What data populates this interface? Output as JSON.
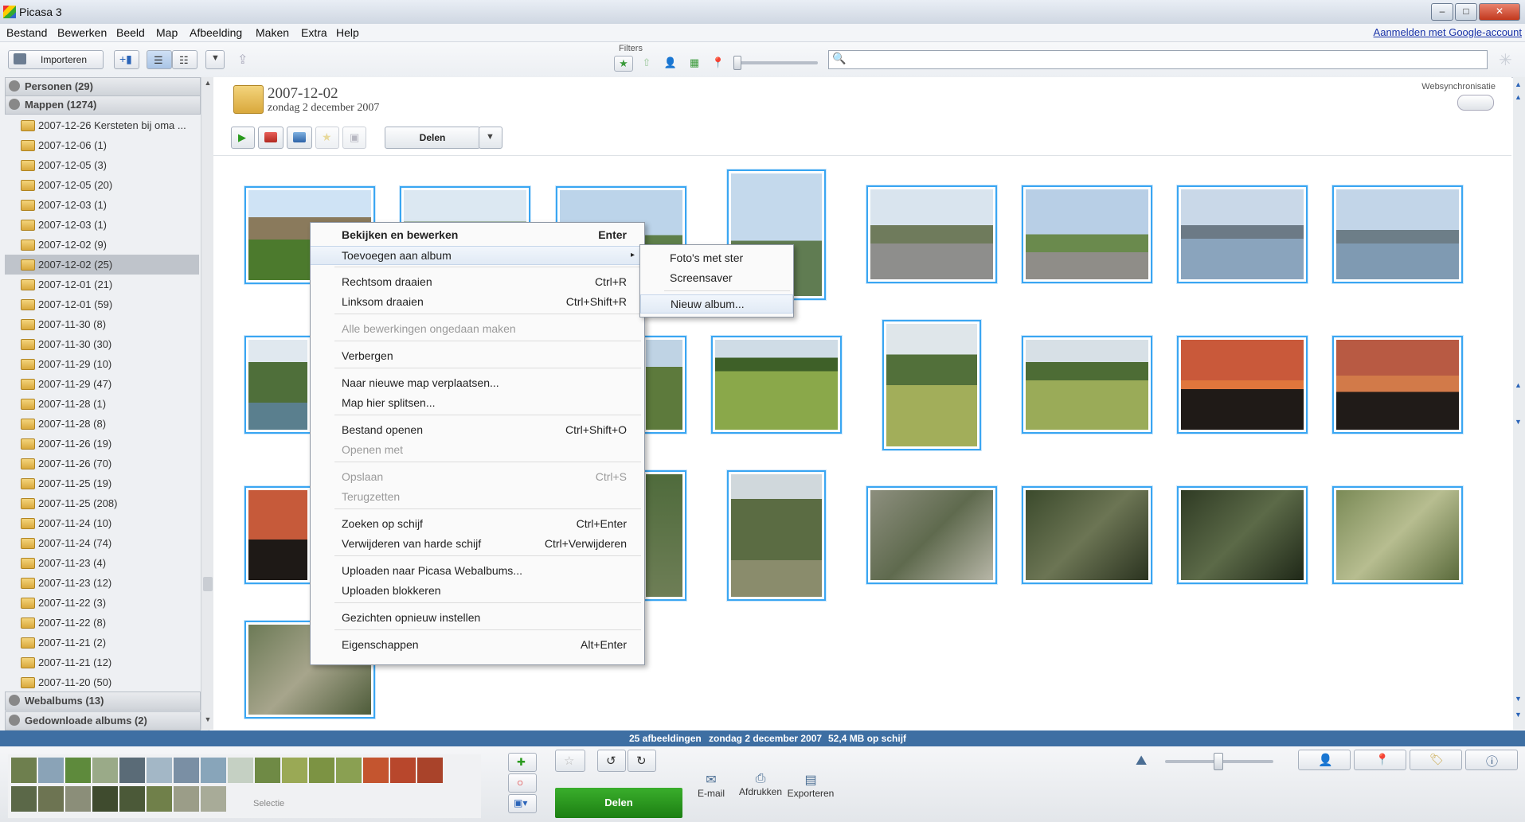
{
  "window": {
    "title": "Picasa 3",
    "btn_min": "–",
    "btn_max": "□",
    "btn_close": "✕"
  },
  "menubar": {
    "items": [
      "Bestand",
      "Bewerken",
      "Beeld",
      "Map",
      "Afbeelding",
      "Maken",
      "Extra",
      "Help"
    ],
    "signin": "Aanmelden met Google-account"
  },
  "toolbar": {
    "import_label": "Importeren",
    "filters_label": "Filters",
    "search_placeholder": ""
  },
  "sidebar": {
    "people": "Personen (29)",
    "folders": "Mappen (1274)",
    "folder_items": [
      "2007-12-26 Kersteten bij oma ...",
      "2007-12-06 (1)",
      "2007-12-05 (3)",
      "2007-12-05 (20)",
      "2007-12-03 (1)",
      "2007-12-03 (1)",
      "2007-12-02 (9)",
      "2007-12-02 (25)",
      "2007-12-01 (21)",
      "2007-12-01 (59)",
      "2007-11-30 (8)",
      "2007-11-30 (30)",
      "2007-11-29 (10)",
      "2007-11-29 (47)",
      "2007-11-28 (1)",
      "2007-11-28 (8)",
      "2007-11-26 (19)",
      "2007-11-26 (70)",
      "2007-11-25 (19)",
      "2007-11-25 (208)",
      "2007-11-24 (10)",
      "2007-11-24 (74)",
      "2007-11-23 (4)",
      "2007-11-23 (12)",
      "2007-11-22 (3)",
      "2007-11-22 (8)",
      "2007-11-21 (2)",
      "2007-11-21 (12)",
      "2007-11-20 (50)"
    ],
    "webalbums": "Webalbums (13)",
    "downloaded": "Gedownloade albums (2)"
  },
  "main": {
    "title": "2007-12-02",
    "subtitle": "zondag 2 december 2007",
    "websync": "Websynchronisatie",
    "share": "Delen"
  },
  "context_menu": {
    "items": [
      {
        "label": "Bekijken en bewerken",
        "shortcut": "Enter"
      },
      {
        "label": "Toevoegen aan album",
        "shortcut": "",
        "arrow": "▸"
      },
      {
        "label": "Rechtsom draaien",
        "shortcut": "Ctrl+R"
      },
      {
        "label": "Linksom draaien",
        "shortcut": "Ctrl+Shift+R"
      },
      {
        "label": "Alle bewerkingen ongedaan maken",
        "shortcut": ""
      },
      {
        "label": "Verbergen",
        "shortcut": ""
      },
      {
        "label": "Naar nieuwe map verplaatsen...",
        "shortcut": ""
      },
      {
        "label": "Map hier splitsen...",
        "shortcut": ""
      },
      {
        "label": "Bestand openen",
        "shortcut": "Ctrl+Shift+O"
      },
      {
        "label": "Openen met",
        "shortcut": ""
      },
      {
        "label": "Opslaan",
        "shortcut": "Ctrl+S"
      },
      {
        "label": "Terugzetten",
        "shortcut": ""
      },
      {
        "label": "Zoeken op schijf",
        "shortcut": "Ctrl+Enter"
      },
      {
        "label": "Verwijderen van harde schijf",
        "shortcut": "Ctrl+Verwijderen"
      },
      {
        "label": "Uploaden naar Picasa Webalbums...",
        "shortcut": ""
      },
      {
        "label": "Uploaden blokkeren",
        "shortcut": ""
      },
      {
        "label": "Gezichten opnieuw instellen",
        "shortcut": ""
      },
      {
        "label": "Eigenschappen",
        "shortcut": "Alt+Enter"
      }
    ]
  },
  "submenu": {
    "items": [
      "Foto's met ster",
      "Screensaver",
      "Nieuw album..."
    ]
  },
  "status": {
    "count": "25 afbeeldingen",
    "date": "zondag 2 december 2007",
    "size": "52,4 MB op schijf"
  },
  "bottom": {
    "selection": "Selectie",
    "share": "Delen",
    "email": "E-mail",
    "print": "Afdrukken",
    "export": "Exporteren"
  },
  "colors": {
    "accent": "#3aa6f2",
    "share_green": "#2a9a1e",
    "status_bar": "#3e6fa3"
  }
}
